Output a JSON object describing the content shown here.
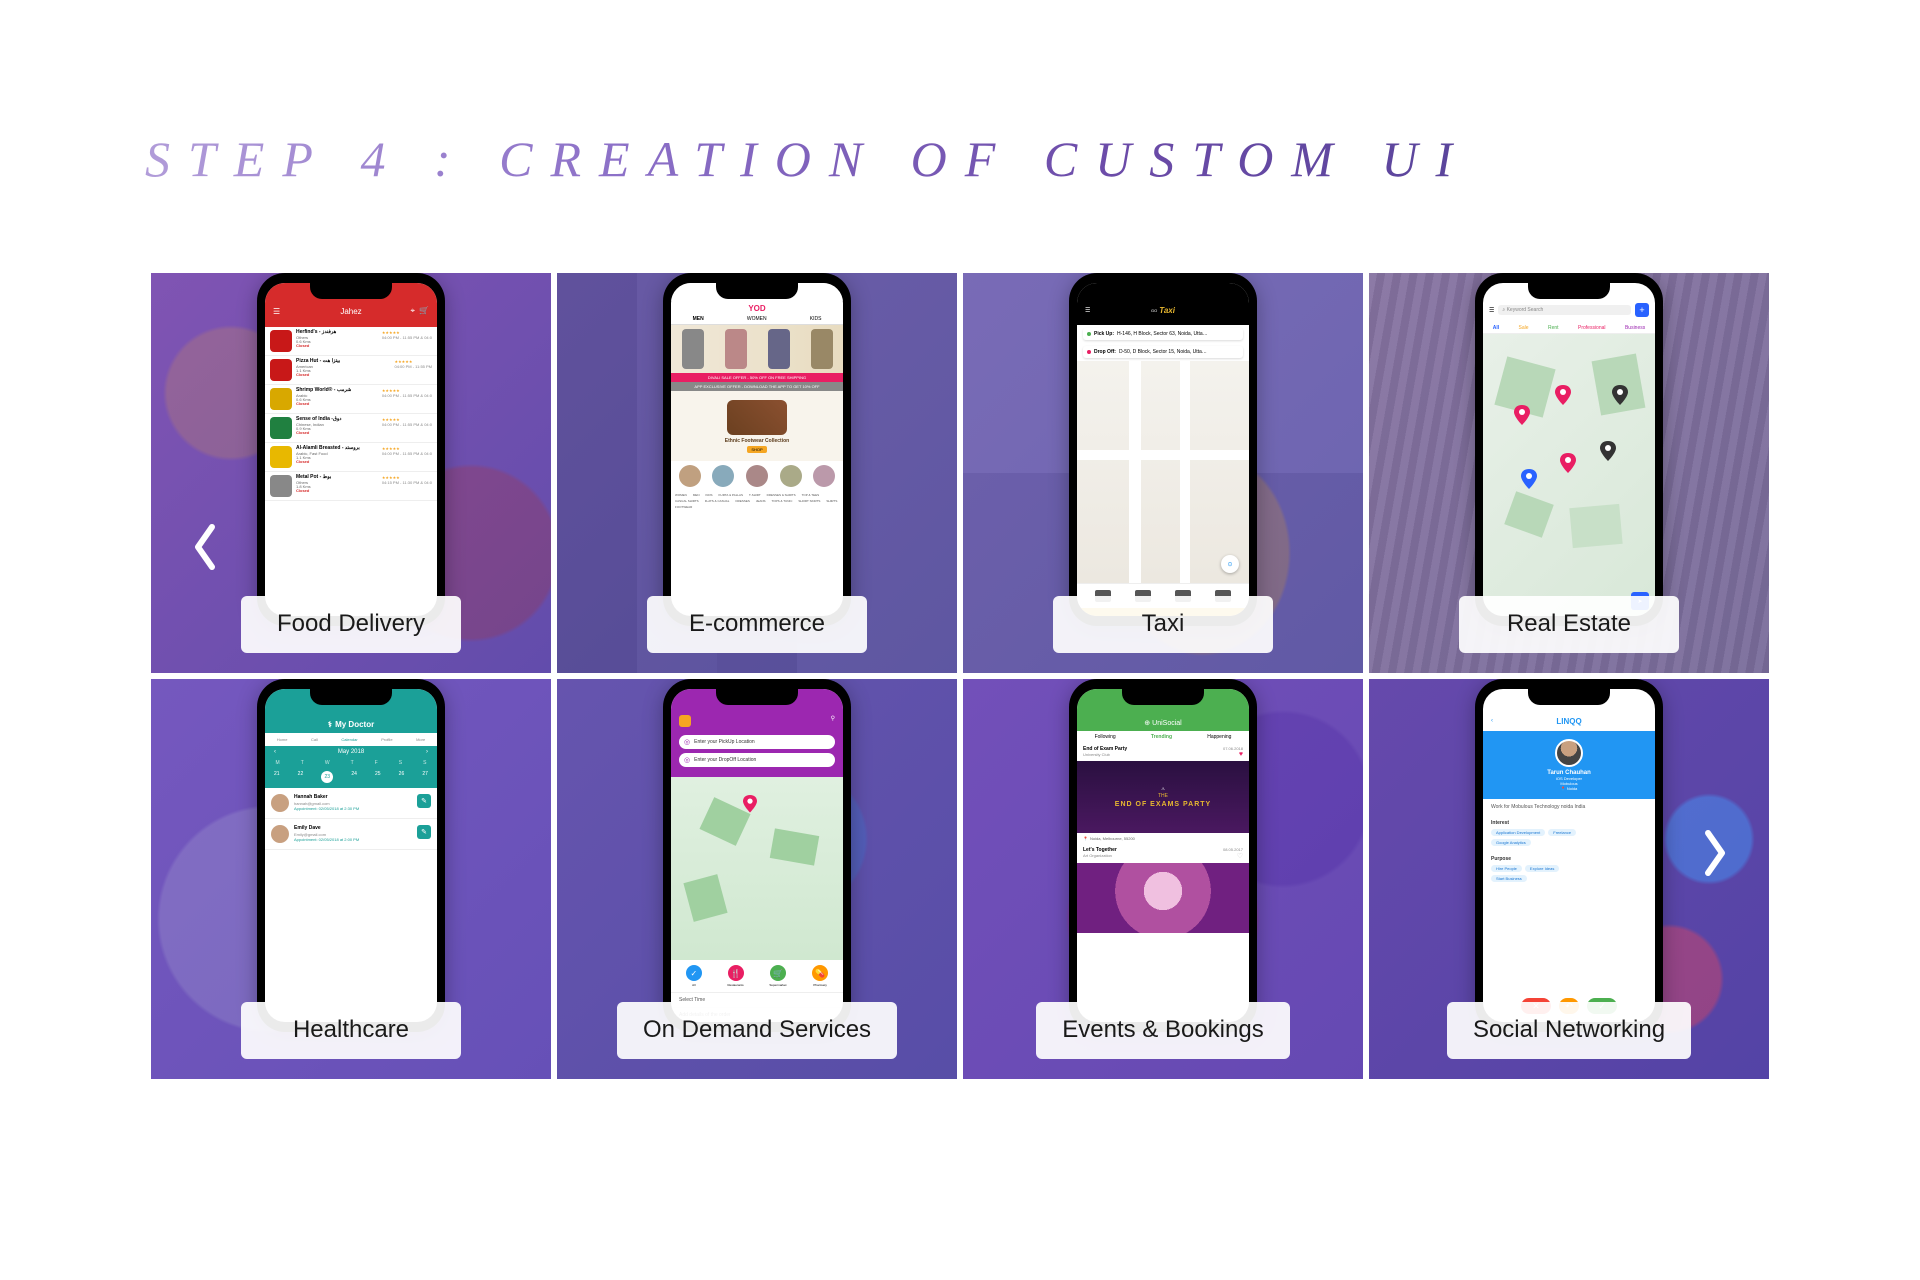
{
  "title": "STEP 4 : CREATION OF CUSTOM UI",
  "cards": [
    {
      "label": "Food Delivery"
    },
    {
      "label": "E-commerce"
    },
    {
      "label": "Taxi"
    },
    {
      "label": "Real Estate"
    },
    {
      "label": "Healthcare"
    },
    {
      "label": "On Demand Services"
    },
    {
      "label": "Events & Bookings"
    },
    {
      "label": "Social Networking"
    }
  ],
  "food": {
    "brand": "Jahez",
    "items": [
      {
        "name": "Herfind's - هرفندز",
        "cuisine": "Others",
        "dist": "0.6 Kms",
        "status": "Closed",
        "time": "04:00 PM - 11:55 PM & 04:0",
        "color": "#c81818"
      },
      {
        "name": "Pizza Hut - بيتزا هت",
        "cuisine": "American",
        "dist": "1.1 Kms",
        "status": "Closed",
        "time": "04:00 PM - 11:55 PM",
        "color": "#c81818"
      },
      {
        "name": "Shrimp World® - شرمب",
        "cuisine": "Arabic",
        "dist": "0.6 Kms",
        "status": "Closed",
        "time": "04:00 PM - 11:55 PM & 04:0",
        "color": "#d8a800"
      },
      {
        "name": "Sense of India -دوق",
        "cuisine": "Chinese, Indian",
        "dist": "0.9 Kms",
        "status": "Closed",
        "time": "04:00 PM - 11:55 PM & 04:0",
        "color": "#208040"
      },
      {
        "name": "Al-Alamli Breasted - بروستد",
        "cuisine": "Arabic, Fast Food",
        "dist": "1.1 Kms",
        "status": "Closed",
        "time": "04:00 PM - 11:55 PM & 04:0",
        "color": "#e8b800"
      },
      {
        "name": "Metal Pot - بوط",
        "cuisine": "Others",
        "dist": "1.8 Kms",
        "status": "Closed",
        "time": "04:15 PM - 11:30 PM & 04:0",
        "color": "#888"
      }
    ]
  },
  "ecom": {
    "brand": "YOD",
    "tabs": [
      "MEN",
      "WOMEN",
      "KIDS"
    ],
    "banner": "DIVALI SALE OFFER - 50% OFF ON FREE SHIPPING",
    "promo": "APP EXCLUSIVE OFFER - DOWNLOAD THE APP TO GET 10% OFF",
    "feature": "Ethnic Footwear Collection",
    "shop": "SHOP",
    "cats": [
      "WOMEN",
      "MEN",
      "KIDS",
      "KURTA & PALLAS",
      "T-SHIRT",
      "DRESSES & SHIRTS",
      "TOP & TEES",
      "CASUAL SHIRTS",
      "FLATS & CASUAL",
      "DRESSES",
      "JEANS",
      "TOPS & TUNIC",
      "SHORT SKIRTS",
      "SHIRTS",
      "FOOTWEAR"
    ]
  },
  "taxi": {
    "brand_prefix": "GO",
    "brand": "Taxi",
    "pickup_label": "Pick Up:",
    "pickup": "H-146, H Block, Sector 63, Noida, Utta…",
    "dropoff_label": "Drop Off:",
    "dropoff": "D-50, D Block, Sector 15, Noida, Utta…"
  },
  "realestate": {
    "search": "Keyword Search",
    "tabs": [
      "All",
      "Sale",
      "Rent",
      "Professional",
      "Business"
    ]
  },
  "health": {
    "brand": "My Doctor",
    "tabs": [
      "Home",
      "Call",
      "Calendar",
      "Profile",
      "More"
    ],
    "month": "May 2018",
    "days": [
      "M",
      "T",
      "W",
      "T",
      "F",
      "S",
      "S"
    ],
    "nums": [
      "21",
      "22",
      "23",
      "24",
      "25",
      "26",
      "27"
    ],
    "appointments": [
      {
        "name": "Hannah Baker",
        "email": "hannah@gmail.com",
        "detail": "Appointment: 02/05/2018 at 2:30 PM"
      },
      {
        "name": "Emily Dave",
        "email": "Emily@gmail.com",
        "detail": "Appointment: 02/05/2018 at 2:00 PM"
      }
    ]
  },
  "ondemand": {
    "pickup": "Enter your PickUp Location",
    "dropoff": "Enter your DropOff Location",
    "cats": [
      {
        "name": "All",
        "color": "#2196f3"
      },
      {
        "name": "Restaurants",
        "color": "#e91e63"
      },
      {
        "name": "Supermarket",
        "color": "#4caf50"
      },
      {
        "name": "Pharmacy",
        "color": "#ff9800"
      }
    ],
    "select_time": "Select Time",
    "details": "Add details of the order"
  },
  "events": {
    "brand": "UniSocial",
    "tabs": [
      "Following",
      "Trending",
      "Happening"
    ],
    "item1_title": "End of Exam Party",
    "item1_sub": "University Club",
    "item1_date": "07.06.2018",
    "banner_line1": "THE",
    "banner_line2": "END OF EXAMS PARTY",
    "loc": "Noida, Melbourne, 55200",
    "item2_title": "Let's Together",
    "item2_sub": "Art Organization",
    "item2_date": "08.05.2017"
  },
  "social": {
    "brand": "LINQQ",
    "name": "Tarun Chauhan",
    "role": "iOS Developer",
    "company": "Mobulous",
    "location": "Noida",
    "work": "Work for Mobulous Technology noida India",
    "sec1": "Interest",
    "tags1": [
      "Application Development",
      "Freelance"
    ],
    "tags1b": [
      "Google Analytics"
    ],
    "sec2": "Purpose",
    "tags2": [
      "Hire People",
      "Explore Ideas"
    ],
    "tags2b": [
      "Start Business"
    ]
  }
}
